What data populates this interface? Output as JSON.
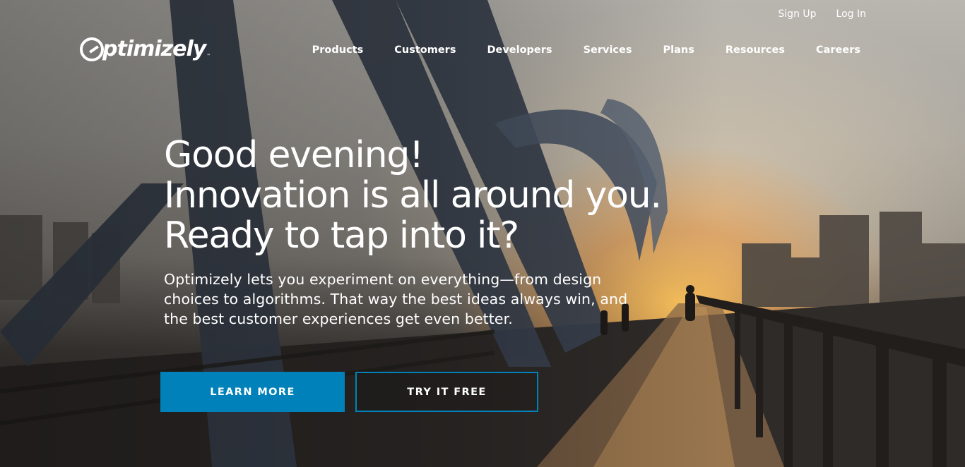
{
  "header": {
    "logo_text": "ptimizely",
    "logo_tm": "™",
    "top_links": [
      "Sign Up",
      "Log In"
    ],
    "nav": [
      "Products",
      "Customers",
      "Developers",
      "Services",
      "Plans",
      "Resources",
      "Careers"
    ]
  },
  "hero": {
    "headline": [
      "Good evening!",
      "Innovation is all around you.",
      "Ready to tap into it?"
    ],
    "subtext": [
      "Optimizely lets you experiment on everything—from design",
      "choices to algorithms. That way the best ideas always win, and",
      "the best customer experiences get even better."
    ],
    "learn_more_label": "LEARN MORE",
    "try_free_label": "TRY IT FREE"
  },
  "colors": {
    "accent": "#0081ba",
    "text": "#ffffff"
  }
}
